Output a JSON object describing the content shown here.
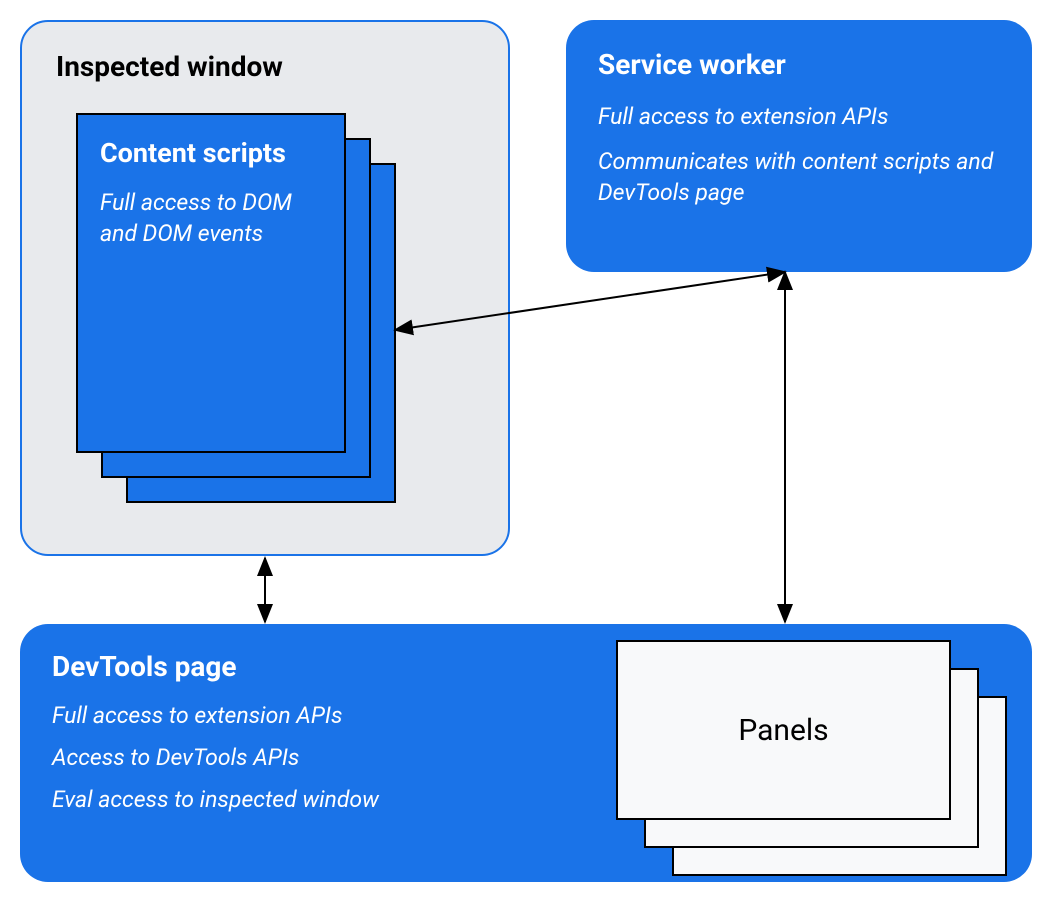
{
  "inspected_window": {
    "title": "Inspected window",
    "content_scripts": {
      "title": "Content scripts",
      "desc": "Full access to DOM and DOM events"
    }
  },
  "service_worker": {
    "title": "Service worker",
    "line1": "Full access to extension APIs",
    "line2": "Communicates with content scripts and DevTools page"
  },
  "devtools_page": {
    "title": "DevTools page",
    "line1": "Full access to extension APIs",
    "line2": "Access to DevTools APIs",
    "line3": "Eval access to inspected window"
  },
  "panels": {
    "label": "Panels"
  },
  "colors": {
    "blue": "#1a73e8",
    "grey_bg": "#e8eaed",
    "panel_bg": "#f8f9fa"
  }
}
